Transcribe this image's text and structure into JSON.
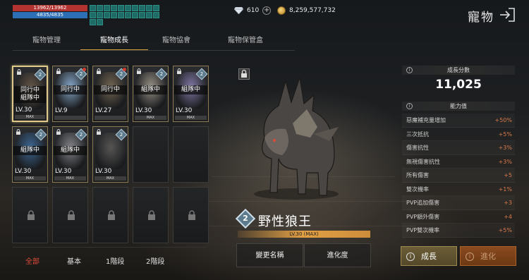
{
  "player": {
    "hp": "13962/13962",
    "mp": "4835/4835"
  },
  "buff_icons": [
    "buff",
    "buff",
    "buff",
    "buff",
    "buff",
    "buff",
    "buff",
    "buff",
    "buff",
    "buff",
    "buff",
    "buff",
    "buff",
    "buff",
    "buff",
    "buff",
    "buff",
    "buff",
    "buff",
    "buff",
    "buff",
    "buff"
  ],
  "currency": {
    "gems": "610",
    "gold": "8,259,577,732"
  },
  "header": {
    "title": "寵物"
  },
  "tabs": [
    {
      "label": "寵物管理"
    },
    {
      "label": "寵物成長"
    },
    {
      "label": "寵物協會"
    },
    {
      "label": "寵物保管盒"
    }
  ],
  "pets": [
    {
      "status": "同行中\n組隊中",
      "level": "LV.30",
      "max": "MAX",
      "tier": "2",
      "color": "#6b5a4a"
    },
    {
      "status": "同行中",
      "level": "LV.9",
      "max": "",
      "tier": "2",
      "color": "#8fb3d8"
    },
    {
      "status": "同行中",
      "level": "LV.27",
      "max": "",
      "tier": "2",
      "color": "#7a6b55"
    },
    {
      "status": "組隊中",
      "level": "LV.30",
      "max": "MAX",
      "tier": "2",
      "color": "#a39a8e"
    },
    {
      "status": "組隊中",
      "level": "LV.30",
      "max": "MAX",
      "tier": "2",
      "color": "#8a7fb2"
    },
    {
      "status": "組隊中",
      "level": "LV.30",
      "max": "MAX",
      "tier": "2",
      "color": "#3f6d9e"
    },
    {
      "status": "組隊中",
      "level": "LV.30",
      "max": "MAX",
      "tier": "2",
      "color": "#8d8d92"
    },
    {
      "status": "",
      "level": "LV.30",
      "max": "MAX",
      "tier": "2",
      "color": "#5c5a58"
    }
  ],
  "filters": [
    {
      "label": "全部"
    },
    {
      "label": "基本"
    },
    {
      "label": "1階段"
    },
    {
      "label": "2階段"
    }
  ],
  "selected_pet": {
    "name": "野性狼王",
    "tier": "2",
    "level": "LV.30 (MAX)"
  },
  "actions": {
    "rename": "變更名稱",
    "evolution": "進化度"
  },
  "growth": {
    "score_label": "成長分數",
    "score": "11,025",
    "stats_label": "能力值",
    "stats": [
      {
        "name": "惡魔補充量增加",
        "value": "+50%"
      },
      {
        "name": "三次抵抗",
        "value": "+5%"
      },
      {
        "name": "傷害抗性",
        "value": "+3%"
      },
      {
        "name": "無視傷害抗性",
        "value": "+3%"
      },
      {
        "name": "所有傷害",
        "value": "+5"
      },
      {
        "name": "雙次機率",
        "value": "+1%"
      },
      {
        "name": "PVP追加傷害",
        "value": "+3"
      },
      {
        "name": "PVP額外傷害",
        "value": "+4"
      },
      {
        "name": "PVP雙次機率",
        "value": "+5%"
      }
    ]
  },
  "buttons": {
    "grow": "成長",
    "evolve": "進化"
  }
}
